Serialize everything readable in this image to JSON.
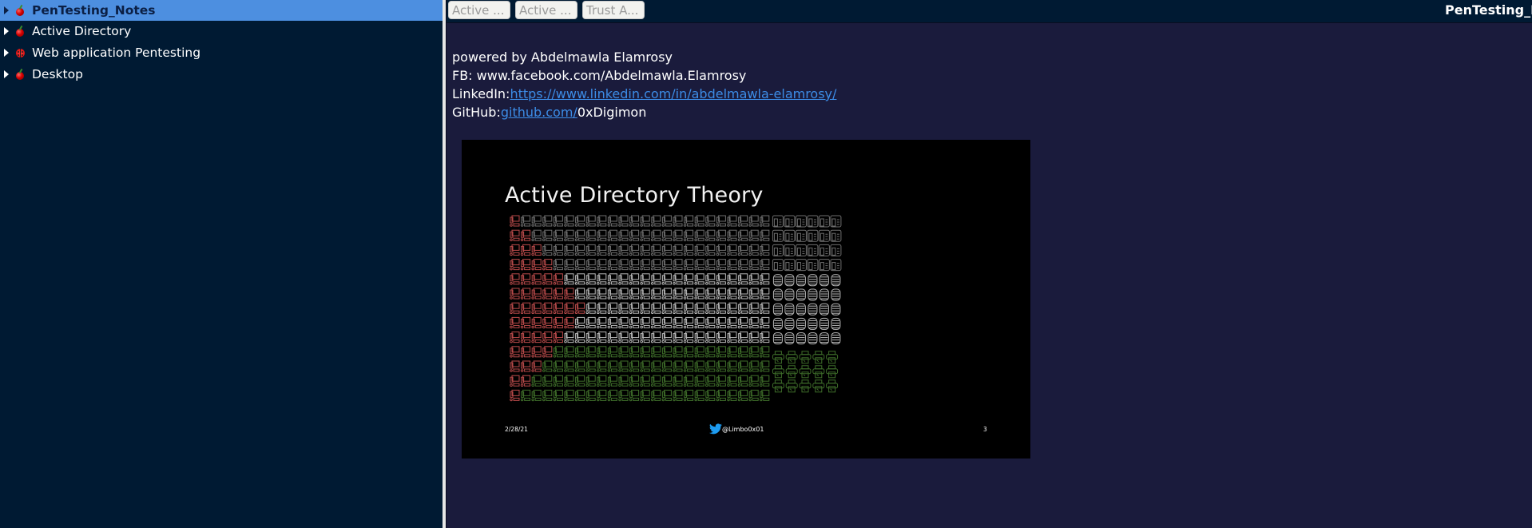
{
  "sidebar": {
    "items": [
      {
        "label": "PenTesting_Notes",
        "icon": "cherry-icon",
        "selected": true
      },
      {
        "label": "Active Directory",
        "icon": "cherry-icon",
        "selected": false
      },
      {
        "label": "Web application Pentesting",
        "icon": "ladybug-icon",
        "selected": false
      },
      {
        "label": "Desktop",
        "icon": "cherry-icon",
        "selected": false
      }
    ]
  },
  "tabs": [
    {
      "label": "Active ..."
    },
    {
      "label": "Active ..."
    },
    {
      "label": "Trust A..."
    }
  ],
  "header": {
    "title": "PenTesting_Notes"
  },
  "content": {
    "line1": "powered by Abdelmawla Elamrosy",
    "line2": "FB: www.facebook.com/Abdelmawla.Elamrosy",
    "linkedin_label": "LinkedIn:",
    "linkedin_link": "https://www.linkedin.com/in/abdelmawla-elamrosy/",
    "github_label": "GitHub:",
    "github_link": "github.com/",
    "github_suffix": "0xDigimon"
  },
  "slide": {
    "title": "Active Directory Theory",
    "date": "2/28/21",
    "handle": "@Limbo0x01",
    "page_number": "3",
    "grid": {
      "rows": 13,
      "computer_columns": 24,
      "red_counts_per_row": [
        1,
        2,
        3,
        4,
        5,
        6,
        7,
        6,
        5,
        4,
        3,
        2,
        1
      ],
      "row_colors": [
        "dark",
        "dark",
        "dark",
        "dark",
        "light",
        "light",
        "light",
        "light",
        "light",
        "green",
        "green",
        "green",
        "green"
      ],
      "server_rows": 4,
      "database_rows": 5,
      "printer_rows": 3,
      "servers_per_row": 6,
      "databases_per_row": 6,
      "printers_per_row": 5
    },
    "colors": {
      "red": "#b84a4a",
      "dark": "#6e6e6e",
      "light": "#b8b8b8",
      "green": "#3f6e2a",
      "twitter": "#1d9bf0"
    }
  }
}
